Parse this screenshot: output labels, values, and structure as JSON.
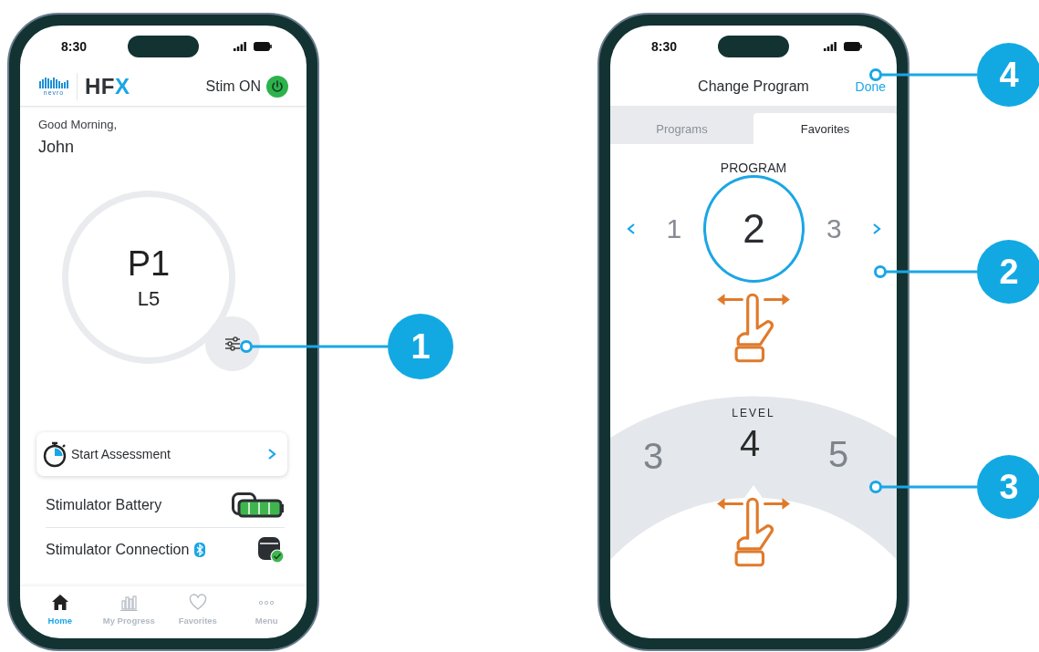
{
  "home_screen": {
    "status_bar": {
      "time": "8:30"
    },
    "header": {
      "brand_mark": "nevro",
      "product_logo": "HFX",
      "stim_label": "Stim ON",
      "stim_on": true
    },
    "greeting": "Good Morning,",
    "user_name": "John",
    "program": {
      "name": "P1",
      "level": "L5"
    },
    "assessment": {
      "label": "Start Assessment"
    },
    "status_rows": [
      {
        "kind": "battery",
        "label": "Stimulator Battery"
      },
      {
        "kind": "connection",
        "label": "Stimulator Connection"
      }
    ],
    "nav": [
      {
        "label": "Home",
        "selected": true
      },
      {
        "label": "My Progress",
        "selected": false
      },
      {
        "label": "Favorites",
        "selected": false
      },
      {
        "label": "Menu",
        "selected": false
      }
    ]
  },
  "change_program_screen": {
    "status_bar": {
      "time": "8:30"
    },
    "title": "Change Program",
    "done": "Done",
    "tabs": [
      {
        "label": "Programs",
        "selected": false
      },
      {
        "label": "Favorites",
        "selected": true
      }
    ],
    "program_label": "PROGRAM",
    "program_items": [
      {
        "label": "1",
        "selected": false
      },
      {
        "label": "2",
        "selected": true
      },
      {
        "label": "3",
        "selected": false
      }
    ],
    "level_label": "LEVEL",
    "level_items": [
      {
        "label": "3",
        "selected": false
      },
      {
        "label": "4",
        "selected": true
      },
      {
        "label": "5",
        "selected": false
      }
    ]
  },
  "callouts": [
    {
      "number": "1"
    },
    {
      "number": "4"
    },
    {
      "number": "2"
    },
    {
      "number": "3"
    }
  ]
}
